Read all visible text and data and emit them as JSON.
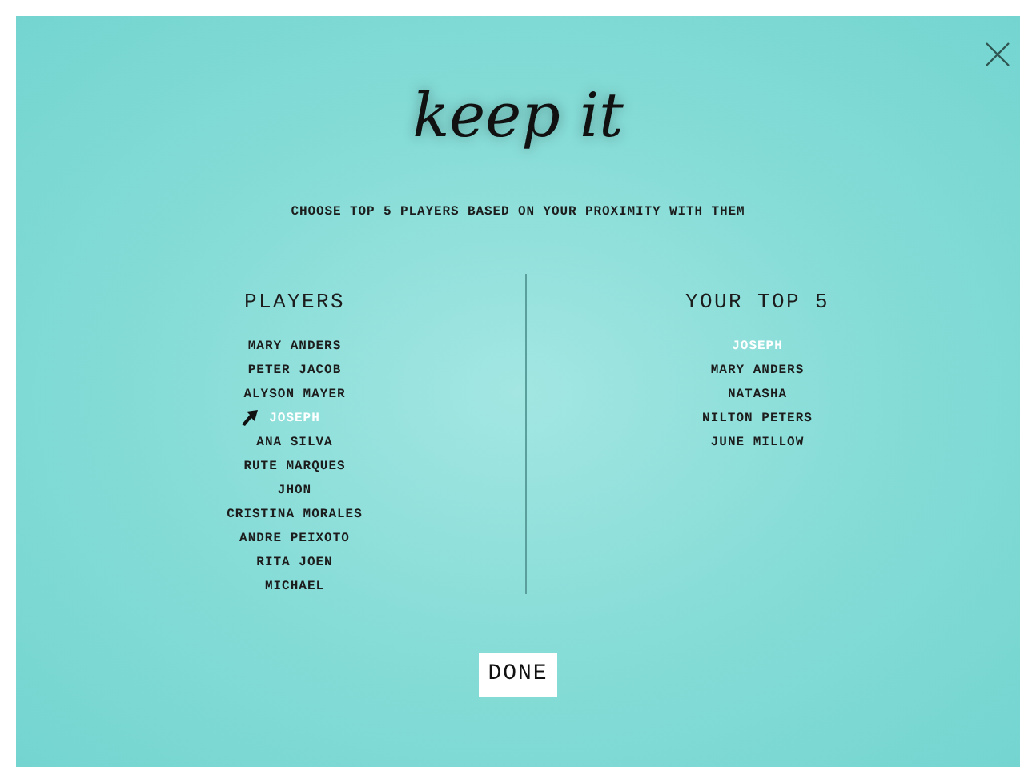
{
  "logo": "keep it",
  "instruction": "CHOOSE TOP 5 PLAYERS BASED ON YOUR PROXIMITY WITH THEM",
  "players": {
    "title": "PLAYERS",
    "items": [
      {
        "name": "MARY ANDERS",
        "selected": false
      },
      {
        "name": "PETER JACOB",
        "selected": false
      },
      {
        "name": "ALYSON MAYER",
        "selected": false
      },
      {
        "name": "JOSEPH",
        "selected": true
      },
      {
        "name": "ANA SILVA",
        "selected": false
      },
      {
        "name": "RUTE MARQUES",
        "selected": false
      },
      {
        "name": "JHON",
        "selected": false
      },
      {
        "name": "CRISTINA MORALES",
        "selected": false
      },
      {
        "name": "ANDRE PEIXOTO",
        "selected": false
      },
      {
        "name": "RITA JOEN",
        "selected": false
      },
      {
        "name": "MICHAEL",
        "selected": false
      }
    ]
  },
  "top5": {
    "title": "YOUR TOP 5",
    "items": [
      {
        "name": "JOSEPH",
        "selected": true
      },
      {
        "name": "MARY ANDERS",
        "selected": false
      },
      {
        "name": "NATASHA",
        "selected": false
      },
      {
        "name": "NILTON PETERS",
        "selected": false
      },
      {
        "name": "JUNE MILLOW",
        "selected": false
      }
    ]
  },
  "done_button": "DONE"
}
